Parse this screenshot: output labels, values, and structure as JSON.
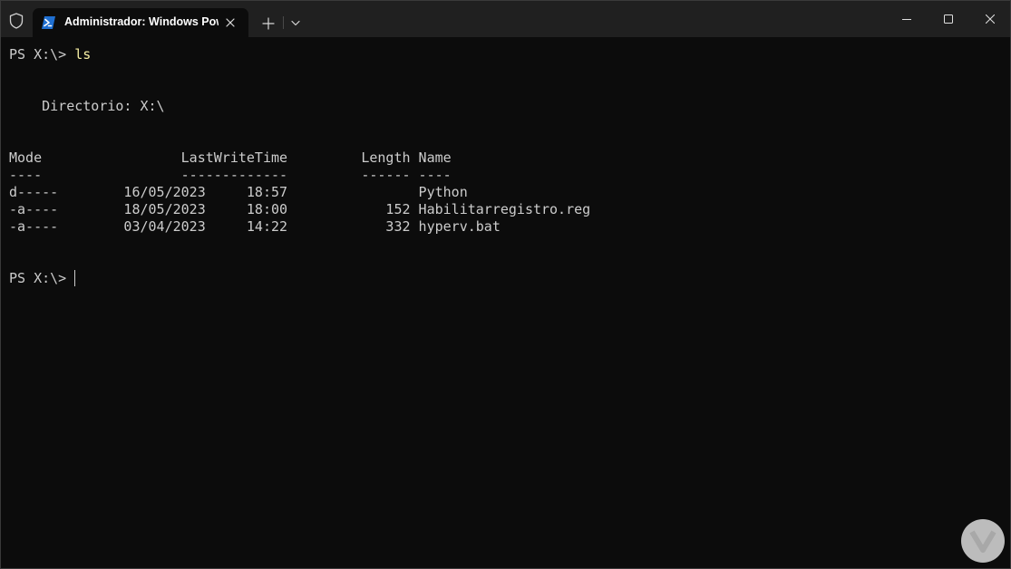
{
  "window": {
    "tab_title": "Administrador: Windows Pow"
  },
  "terminal": {
    "prompt1": "PS X:\\> ",
    "command1": "ls",
    "directory_line": "    Directorio: X:\\",
    "header_line": "Mode                 LastWriteTime         Length Name",
    "underline_line": "----                 -------------         ------ ----",
    "rows": [
      "d-----        16/05/2023     18:57                Python",
      "-a----        18/05/2023     18:00            152 Habilitarregistro.reg",
      "-a----        03/04/2023     14:22            332 hyperv.bat"
    ],
    "prompt2": "PS X:\\> "
  },
  "colors": {
    "background": "#0c0c0c",
    "titlebar": "#202020",
    "text": "#cccccc",
    "command": "#f9f1a5",
    "powershell_icon": "#1f6fd1"
  },
  "icons": {
    "shield": "shield-icon",
    "powershell": "powershell-icon",
    "tab_close": "close-icon",
    "new_tab": "plus-icon",
    "dropdown": "chevron-down-icon",
    "minimize": "minimize-icon",
    "maximize": "maximize-icon",
    "close": "close-icon"
  }
}
